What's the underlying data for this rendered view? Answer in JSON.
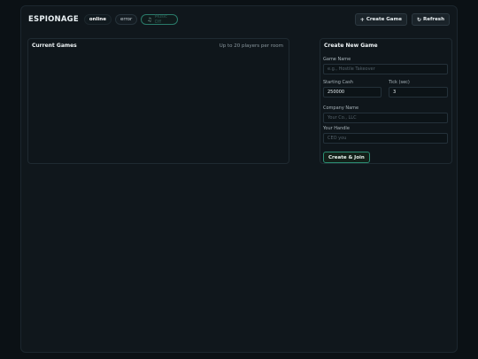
{
  "header": {
    "brand": "ESPIONAGE",
    "status_online": "online",
    "status_error": "error",
    "music_icon": "music-note-icon",
    "music_label": "Music Off",
    "create_game_label": "Create Game",
    "create_game_icon": "plus-icon",
    "refresh_label": "Refresh",
    "refresh_icon": "refresh-icon"
  },
  "current_games": {
    "title": "Current Games",
    "subtitle": "Up to 20 players per room"
  },
  "create_form": {
    "title": "Create New Game",
    "game_name_label": "Game Name",
    "game_name_placeholder": "e.g., Hostile Takeover",
    "starting_cash_label": "Starting Cash",
    "starting_cash_value": "250000",
    "tick_label": "Tick (sec)",
    "tick_value": "3",
    "company_name_label": "Company Name",
    "company_name_placeholder": "Your Co., LLC",
    "handle_label": "Your Handle",
    "handle_placeholder": "CEO you",
    "submit_label": "Create & Join"
  },
  "colors": {
    "background": "#0b1115",
    "panel": "#0f161b",
    "accent": "#2b8e73"
  }
}
